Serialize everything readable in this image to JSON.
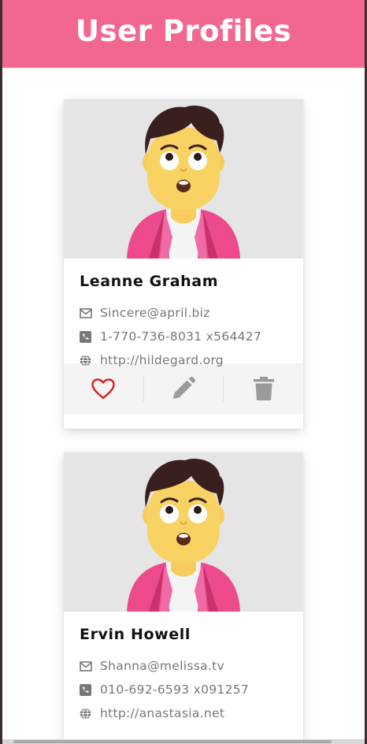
{
  "header": {
    "title": "User Profiles"
  },
  "colors": {
    "accent": "#f2678f",
    "heart": "#e0101c",
    "icon_gray": "#9a9a9a"
  },
  "users": [
    {
      "name": "Leanne Graham",
      "email": "Sincere@april.biz",
      "phone": "1-770-736-8031 x564427",
      "website": "http://hildegard.org"
    },
    {
      "name": "Ervin Howell",
      "email": "Shanna@melissa.tv",
      "phone": "010-692-6593 x091257",
      "website": "http://anastasia.net"
    }
  ],
  "icons": {
    "email": "envelope-icon",
    "phone": "phone-icon",
    "website": "globe-icon",
    "like": "heart-icon",
    "edit": "pencil-icon",
    "delete": "trash-icon"
  }
}
